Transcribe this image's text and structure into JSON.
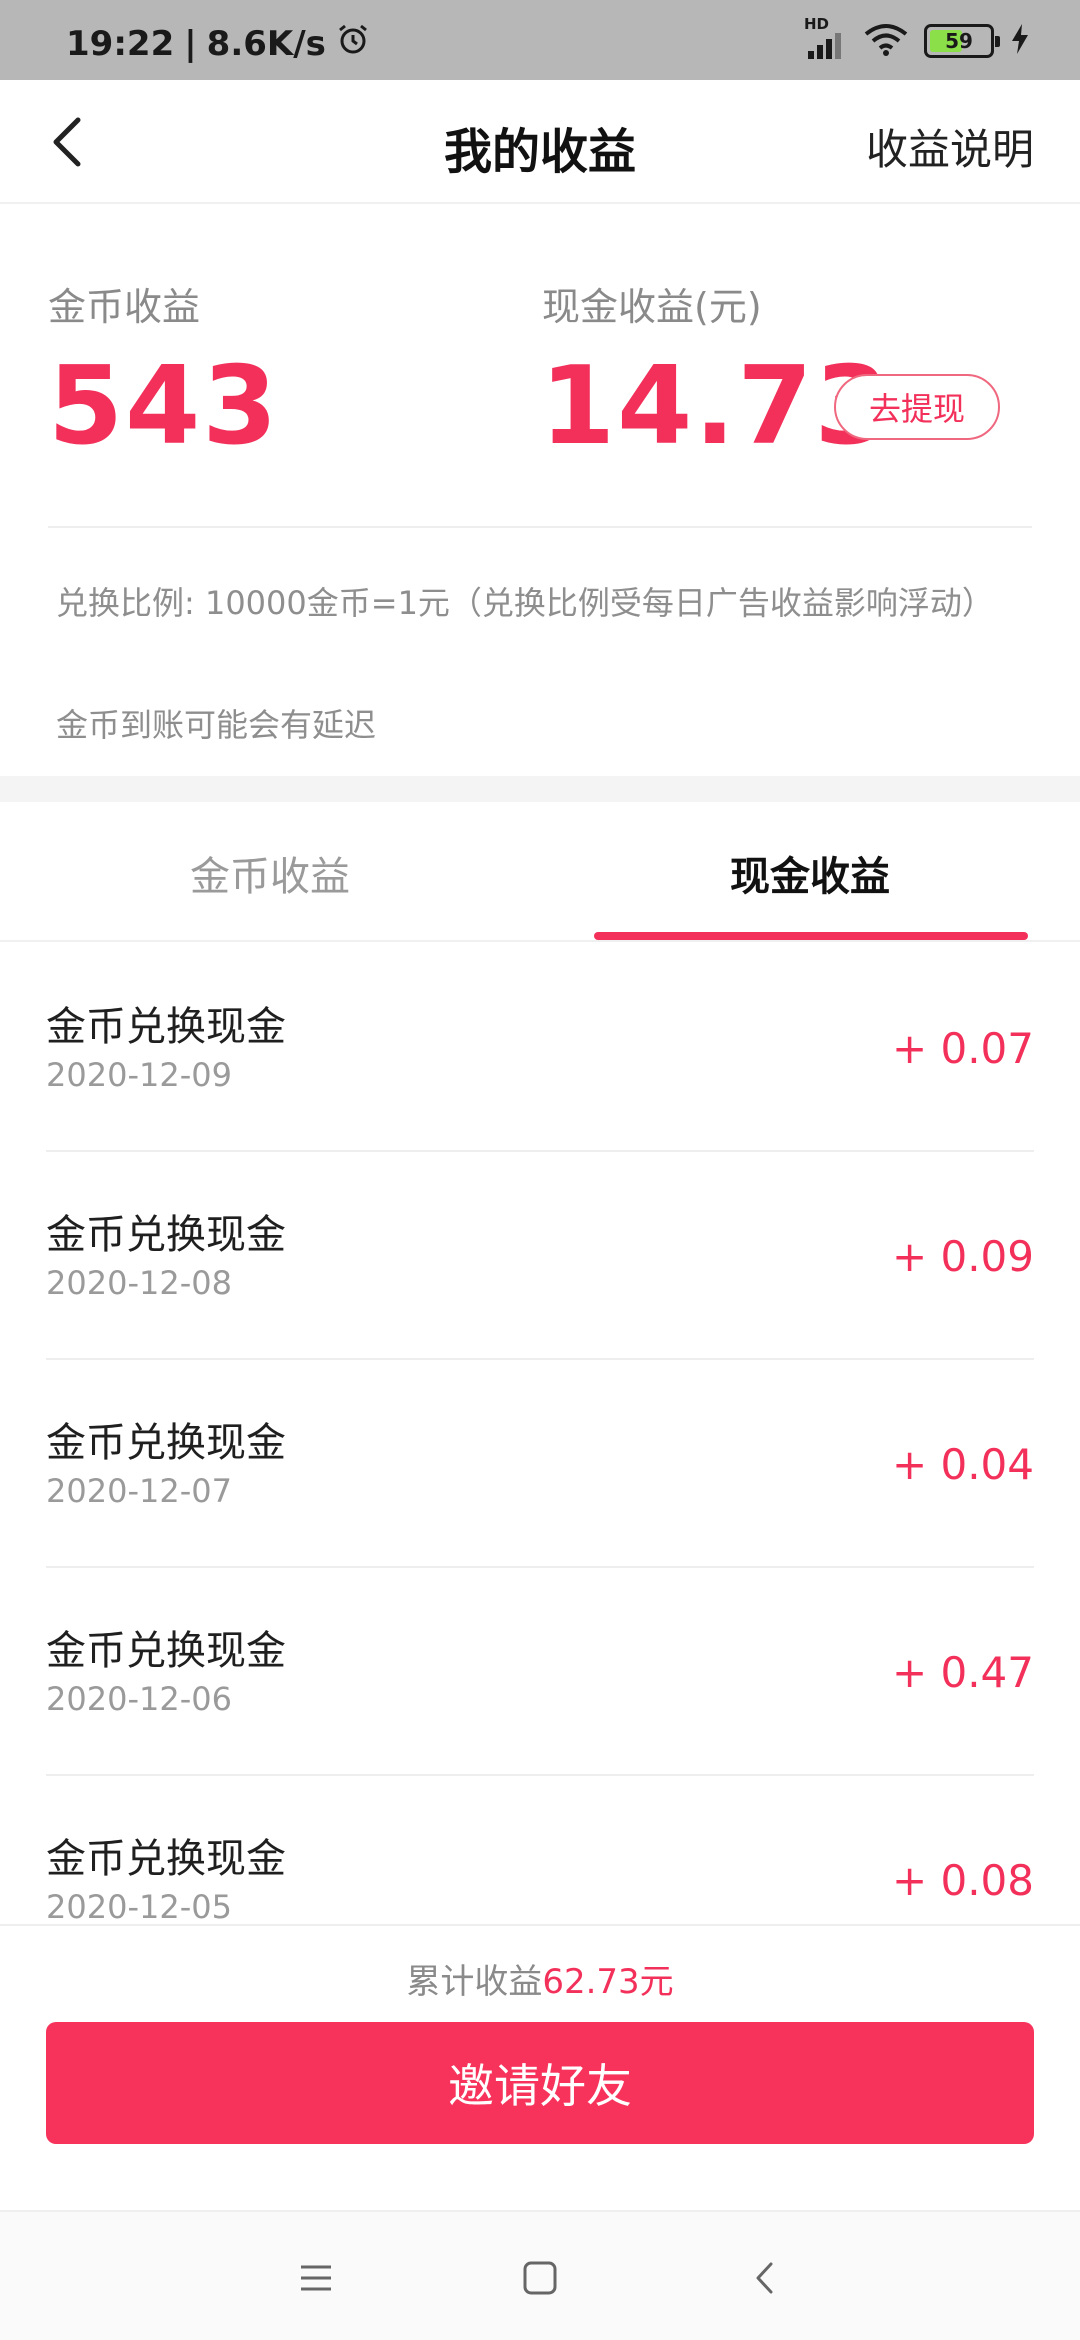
{
  "status_bar": {
    "time": "19:22",
    "net_speed": "8.6K/s",
    "hd_label": "HD",
    "battery_level": "59",
    "battery_fraction": 0.59
  },
  "header": {
    "title": "我的收益",
    "explain_label": "收益说明",
    "back_icon": "chevron-left-icon"
  },
  "summary": {
    "coin_label": "金币收益",
    "coin_value": "543",
    "cash_label": "现金收益(元)",
    "cash_value": "14.73",
    "withdraw_label": "去提现",
    "exchange_note": "兑换比例: 10000金币=1元（兑换比例受每日广告收益影响浮动）",
    "delay_note": "金币到账可能会有延迟"
  },
  "tabs": [
    {
      "label": "金币收益",
      "active": false
    },
    {
      "label": "现金收益",
      "active": true
    }
  ],
  "records": [
    {
      "title": "金币兑换现金",
      "date": "2020-12-09",
      "amount": "+ 0.07"
    },
    {
      "title": "金币兑换现金",
      "date": "2020-12-08",
      "amount": "+ 0.09"
    },
    {
      "title": "金币兑换现金",
      "date": "2020-12-07",
      "amount": "+ 0.04"
    },
    {
      "title": "金币兑换现金",
      "date": "2020-12-06",
      "amount": "+ 0.47"
    },
    {
      "title": "金币兑换现金",
      "date": "2020-12-05",
      "amount": "+ 0.08"
    }
  ],
  "footer": {
    "total_label": "累计收益",
    "total_amount": "62.73元",
    "invite_label": "邀请好友"
  },
  "colors": {
    "accent": "#f2305a",
    "status_bar": "#b7b7b7"
  }
}
